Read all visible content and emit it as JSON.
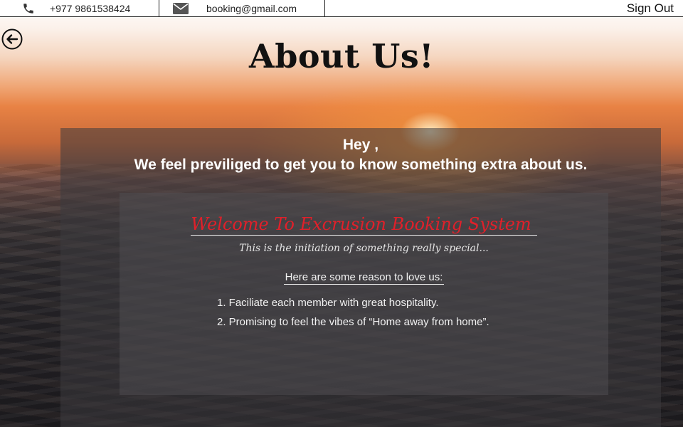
{
  "topbar": {
    "phone_icon": "phone-icon",
    "phone": "+977 9861538424",
    "mail_icon": "envelope-icon",
    "email": "booking@gmail.com",
    "signout_label": "Sign Out"
  },
  "back_icon": "arrow-left-circle-icon",
  "title": "About Us!",
  "intro": {
    "greeting": "Hey ,",
    "message": "We feel previliged to get you to know something extra about us."
  },
  "welcome": {
    "heading": "Welcome To Excrusion Booking System",
    "tagline": "This is the initiation of something really special...",
    "reasons_heading": "Here are some reason to love us:",
    "reasons": [
      "1. Faciliate each member with great hospitality.",
      "2. Promising to feel the vibes of “Home away from home”."
    ]
  },
  "colors": {
    "heading_red": "#e0202a",
    "text_white": "#ffffff"
  }
}
